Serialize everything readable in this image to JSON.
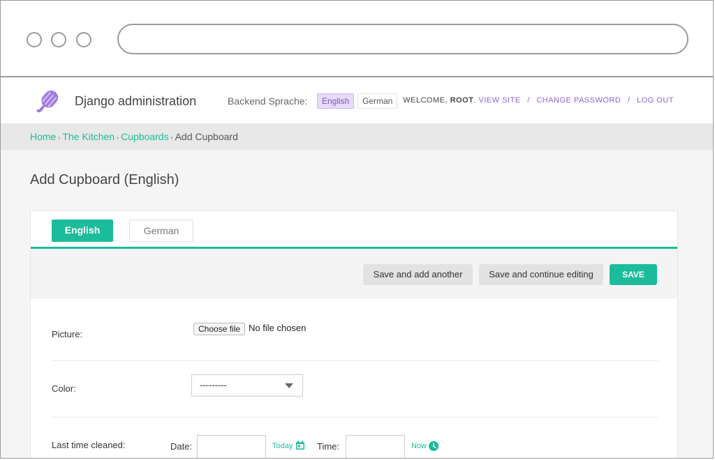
{
  "header": {
    "brand": "Django administration",
    "language_label": "Backend Sprache:",
    "languages": [
      "English",
      "German"
    ],
    "active_language": "English",
    "welcome": "WELCOME,",
    "username": "ROOT",
    "view_site": "VIEW SITE",
    "change_password": "CHANGE PASSWORD",
    "log_out": "LOG OUT"
  },
  "breadcrumbs": {
    "home": "Home",
    "app": "The Kitchen",
    "model": "Cupboards",
    "current": "Add Cupboard"
  },
  "page": {
    "title": "Add Cupboard (English)"
  },
  "tabs": {
    "english": "English",
    "german": "German",
    "active": "English"
  },
  "submit_row": {
    "save_add_another": "Save and add another",
    "save_continue": "Save and continue editing",
    "save": "SAVE"
  },
  "form": {
    "picture": {
      "label": "Picture:",
      "button": "Choose file",
      "status": "No file chosen"
    },
    "color": {
      "label": "Color:",
      "selected": "---------"
    },
    "last_cleaned": {
      "label": "Last time cleaned:",
      "date_label": "Date:",
      "date_value": "",
      "today_link": "Today",
      "time_label": "Time:",
      "time_value": "",
      "now_link": "Now"
    }
  },
  "colors": {
    "accent": "#1bbc9b",
    "link_purple": "#8e63d4"
  }
}
